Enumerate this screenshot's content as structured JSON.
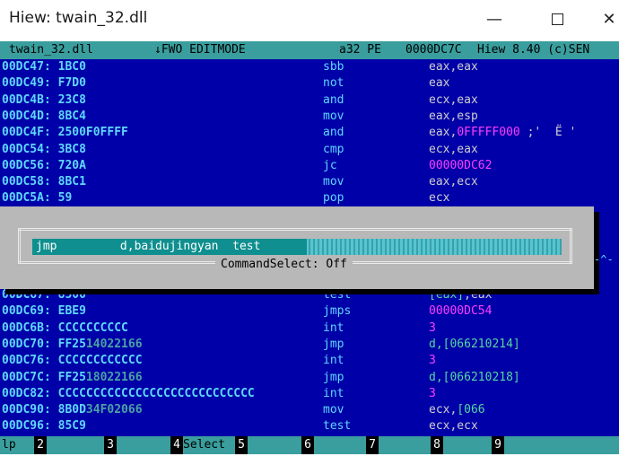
{
  "window": {
    "title": "Hiew: twain_32.dll",
    "minimize": "—",
    "close": "✕"
  },
  "status": {
    "file": "twain_32.dll",
    "mode": "↓FWO EDITMODE",
    "bits": "a32 PE",
    "offset": "0000DC7C",
    "version": "Hiew 8.40 (c)SEN"
  },
  "rows_top": [
    {
      "addr": "00DC47: 1BC0",
      "mnem": "sbb",
      "ops": [
        {
          "t": "eax,eax",
          "c": ""
        }
      ]
    },
    {
      "addr": "00DC49: F7D0",
      "mnem": "not",
      "ops": [
        {
          "t": "eax",
          "c": ""
        }
      ]
    },
    {
      "addr": "00DC4B: 23C8",
      "mnem": "and",
      "ops": [
        {
          "t": "ecx,eax",
          "c": ""
        }
      ]
    },
    {
      "addr": "00DC4D: 8BC4",
      "mnem": "mov",
      "ops": [
        {
          "t": "eax,esp",
          "c": ""
        }
      ]
    },
    {
      "addr": "00DC4F: 2500F0FFFF",
      "mnem": "and",
      "ops": [
        {
          "t": "eax,",
          "c": ""
        },
        {
          "t": "0FFFFF000",
          "c": "mag"
        },
        {
          "t": " ;'  Ё '",
          "c": ""
        }
      ]
    },
    {
      "addr": "00DC54: 3BC8",
      "mnem": "cmp",
      "ops": [
        {
          "t": "ecx,eax",
          "c": ""
        }
      ]
    },
    {
      "addr": "00DC56: 720A",
      "mnem": "jc",
      "ops": [
        {
          "t": "00000DC62",
          "c": "mag"
        }
      ]
    },
    {
      "addr": "00DC58: 8BC1",
      "mnem": "mov",
      "ops": [
        {
          "t": "eax,ecx",
          "c": ""
        }
      ]
    },
    {
      "addr": "00DC5A: 59",
      "mnem": "pop",
      "ops": [
        {
          "t": "ecx",
          "c": ""
        }
      ]
    }
  ],
  "rows_bottom": [
    {
      "addr": "00DC67: 8500",
      "mnem": "test",
      "ops": [
        {
          "t": "[eax]",
          "c": "green"
        },
        {
          "t": ",eax",
          "c": ""
        }
      ]
    },
    {
      "addr": "00DC69: EBE9",
      "mnem": "jmps",
      "ops": [
        {
          "t": "00000DC54",
          "c": "mag"
        }
      ]
    },
    {
      "addr": "00DC6B: CCCCCCCCCC",
      "mnem": "int",
      "ops": [
        {
          "t": "3",
          "c": "mag"
        }
      ]
    },
    {
      "addr": "00DC70: FF25",
      "addr_dim": "14022166",
      "mnem": "jmp",
      "ops": [
        {
          "t": "d,[066210214]",
          "c": "green"
        }
      ]
    },
    {
      "addr": "00DC76: CCCCCCCCCCCC",
      "mnem": "int",
      "ops": [
        {
          "t": "3",
          "c": "mag"
        }
      ]
    },
    {
      "addr": "00DC7C: FF25",
      "addr_dim": "18022166",
      "mnem": "jmp",
      "ops": [
        {
          "t": "d,[066210218]",
          "c": "green"
        }
      ]
    },
    {
      "addr": "00DC82: CCCCCCCCCCCCCCCCCCCCCCCCCCCC",
      "mnem": "int",
      "ops": [
        {
          "t": "3",
          "c": "mag"
        }
      ]
    },
    {
      "addr": "00DC90: 8B0D",
      "addr_dim": "34F02066",
      "mnem": "mov",
      "ops": [
        {
          "t": "ecx,",
          "c": ""
        },
        {
          "t": "[066",
          "c": "green"
        }
      ]
    },
    {
      "addr": "00DC96: 85C9",
      "mnem": "test",
      "ops": [
        {
          "t": "ecx,ecx",
          "c": ""
        }
      ]
    }
  ],
  "dialog": {
    "input_value": "jmp         d,baidujingyan  test",
    "caption": "CommandSelect: Off",
    "scroll_marker": "-^-"
  },
  "fkeys": [
    {
      "num": "",
      "label": "lp"
    },
    {
      "num": "2",
      "label": ""
    },
    {
      "num": "3",
      "label": ""
    },
    {
      "num": "4",
      "label": "Select"
    },
    {
      "num": "5",
      "label": ""
    },
    {
      "num": "6",
      "label": ""
    },
    {
      "num": "7",
      "label": ""
    },
    {
      "num": "8",
      "label": ""
    },
    {
      "num": "9",
      "label": ""
    },
    {
      "num": "",
      "label": ""
    }
  ],
  "colors": {
    "background": "#0000a8",
    "address": "#5fd7ff",
    "immediate": "#ff3cff",
    "memory": "#55d7a0",
    "bar": "#3a9e9e",
    "dialog": "#b8b8b8"
  }
}
